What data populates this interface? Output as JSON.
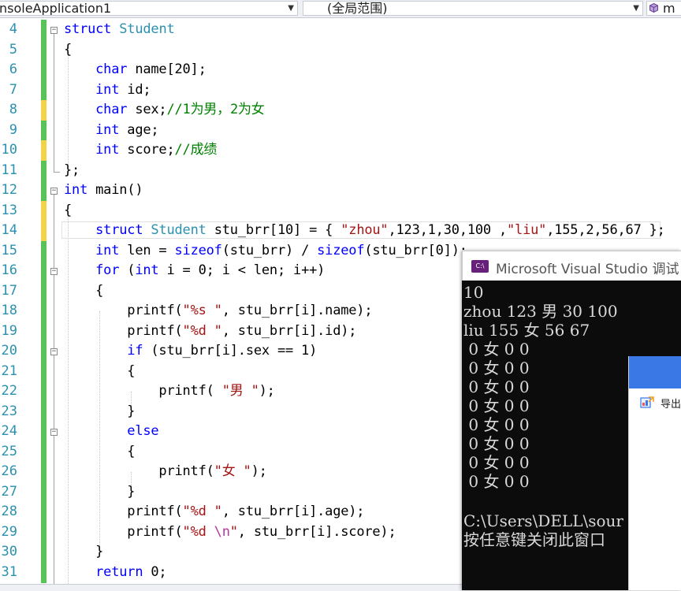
{
  "nav": {
    "project": "nsoleApplication1",
    "scope": "(全局范围)",
    "member": "m"
  },
  "editor": {
    "line_numbers": [
      "4",
      "5",
      "6",
      "7",
      "8",
      "9",
      "10",
      "11",
      "12",
      "13",
      "14",
      "15",
      "16",
      "17",
      "18",
      "19",
      "20",
      "21",
      "22",
      "23",
      "24",
      "25",
      "26",
      "27",
      "28",
      "29",
      "30",
      "31"
    ],
    "colors": {
      "keyword": "#0000ff",
      "type": "#2b91af",
      "comment": "#008000",
      "string": "#a31515",
      "change_saved": "#57c457",
      "change_unsaved": "#f3d449"
    }
  },
  "console": {
    "title": "Microsoft Visual Studio 调试",
    "output": [
      "10",
      "zhou 123 男 30 100",
      "liu 155 女 56 67",
      " 0 女 0 0",
      " 0 女 0 0",
      " 0 女 0 0",
      " 0 女 0 0",
      " 0 女 0 0",
      " 0 女 0 0",
      " 0 女 0 0",
      " 0 女 0 0",
      "",
      "C:\\Users\\DELL\\sour",
      "按任意键关闭此窗口"
    ]
  },
  "popup": {
    "label": "导出"
  }
}
